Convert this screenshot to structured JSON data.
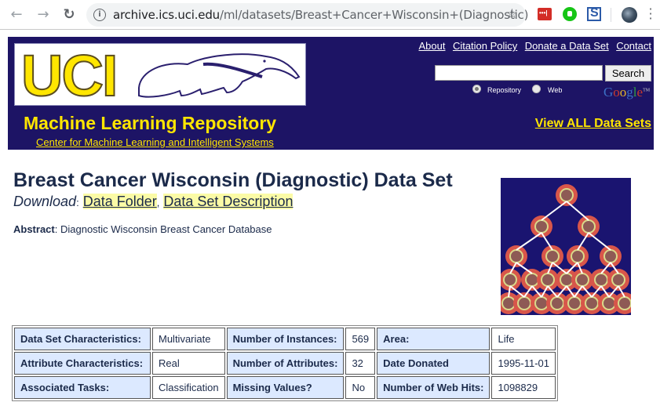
{
  "browser": {
    "url_host": "archive.ics.uci.edu",
    "url_path": "/ml/datasets/Breast+Cancer+Wisconsin+(Diagnostic)",
    "icons": {
      "back": "arrow-left-icon",
      "forward": "arrow-right-icon",
      "reload": "reload-icon",
      "site_info": "info-icon",
      "bookmark": "star-icon",
      "extensions": [
        "lastpass-icon",
        "green-thumb-icon",
        "s-icon"
      ],
      "profile": "globe-avatar-icon",
      "menu": "menu-dots-icon"
    }
  },
  "header": {
    "logo_text": "UCI",
    "title": "Machine Learning Repository",
    "subtitle_link": "Center for Machine Learning and Intelligent Systems",
    "top_links": [
      "About",
      "Citation Policy",
      "Donate a Data Set",
      "Contact"
    ],
    "search": {
      "value": "",
      "button_label": "Search",
      "options": [
        {
          "label": "Repository",
          "checked": true
        },
        {
          "label": "Web",
          "checked": false
        }
      ],
      "google_letters": [
        "G",
        "o",
        "o",
        "g",
        "l",
        "e"
      ],
      "google_tm": "TM"
    },
    "view_all_label": "View ALL Data Sets",
    "colors": {
      "banner": "#1d1465",
      "accent": "#ffe600"
    }
  },
  "dataset": {
    "title": "Breast Cancer Wisconsin (Diagnostic) Data Set",
    "download_label": "Download",
    "download_sep": ":",
    "download_links": [
      "Data Folder",
      "Data Set Description"
    ],
    "link_separator": ",",
    "abstract_label": "Abstract",
    "abstract_text": ": Diagnostic Wisconsin Breast Cancer Database",
    "image_alt": "cell division diagram"
  },
  "table": {
    "rows": [
      [
        {
          "key": "Data Set Characteristics:",
          "value": "Multivariate"
        },
        {
          "key": "Number of Instances:",
          "value": "569"
        },
        {
          "key": "Area:",
          "value": "Life"
        }
      ],
      [
        {
          "key": "Attribute Characteristics:",
          "value": "Real"
        },
        {
          "key": "Number of Attributes:",
          "value": "32"
        },
        {
          "key": "Date Donated",
          "value": "1995-11-01"
        }
      ],
      [
        {
          "key": "Associated Tasks:",
          "value": "Classification"
        },
        {
          "key": "Missing Values?",
          "value": "No"
        },
        {
          "key": "Number of Web Hits:",
          "value": "1098829"
        }
      ]
    ]
  }
}
